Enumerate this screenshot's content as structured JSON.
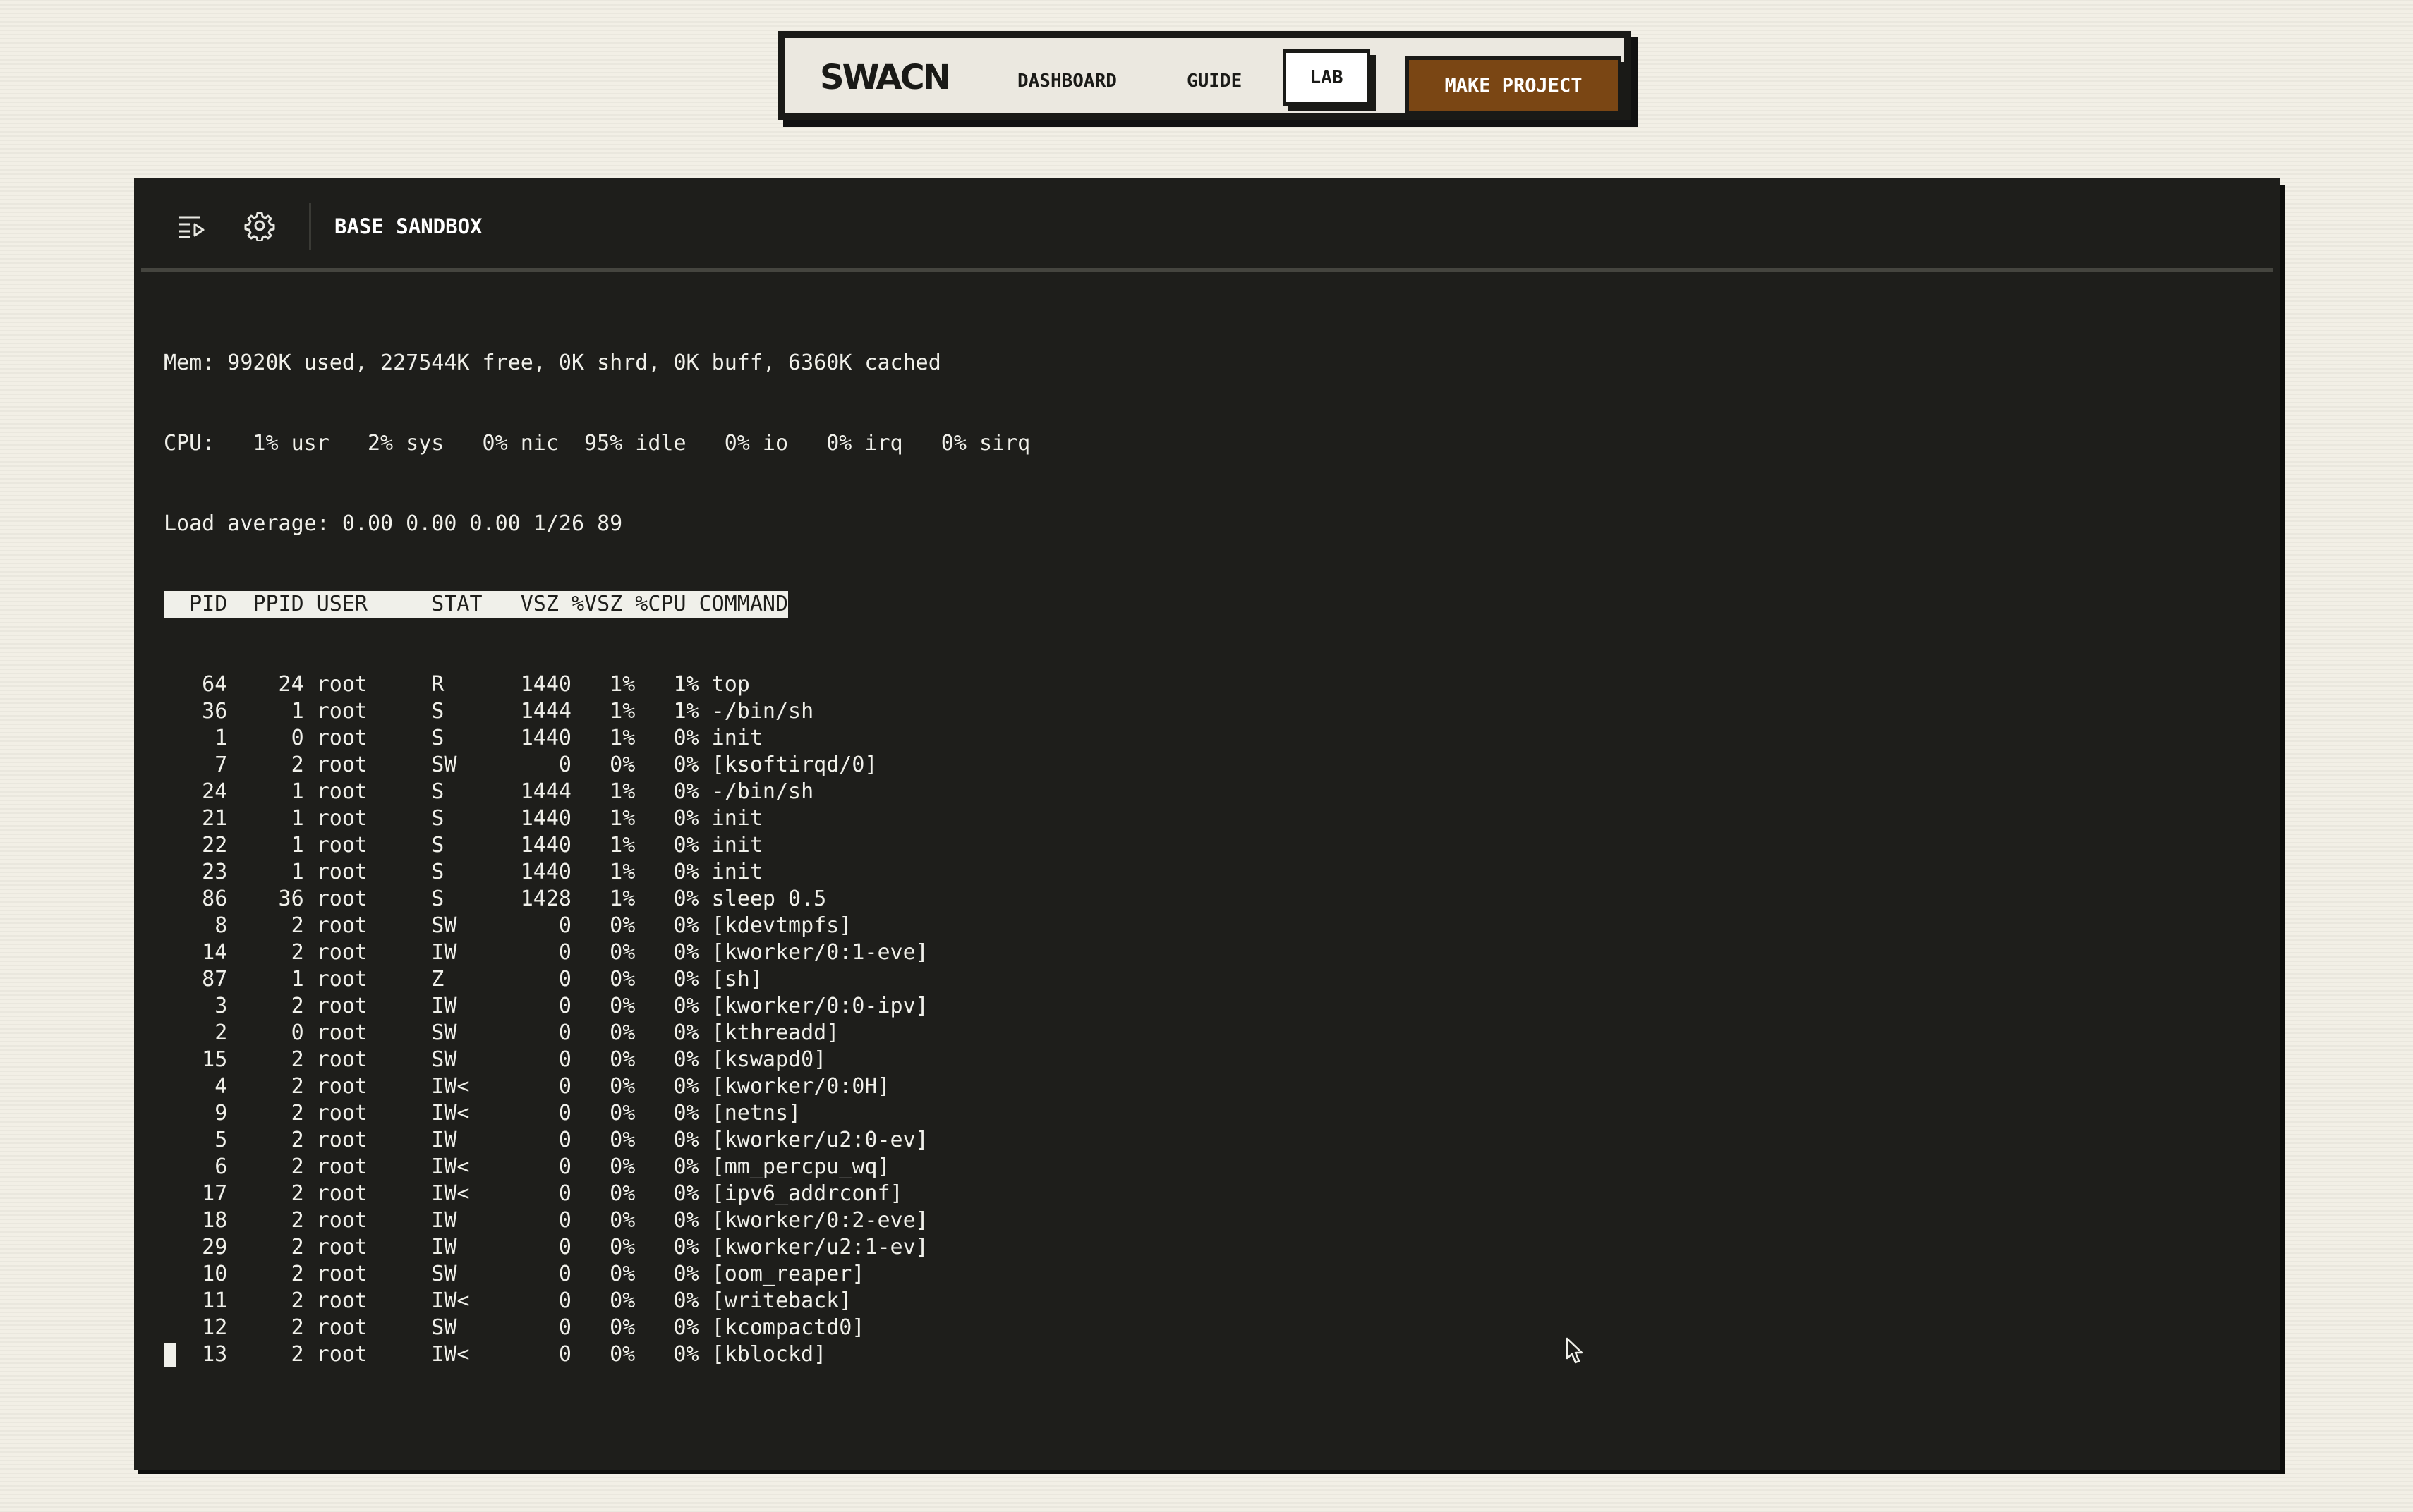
{
  "nav": {
    "logo": "SWACN",
    "links": [
      "DASHBOARD",
      "GUIDE",
      "LAB"
    ],
    "active_link": "LAB",
    "cta": "MAKE PROJECT",
    "cta_color": "#7a4614"
  },
  "terminal": {
    "title": "BASE SANDBOX",
    "icons": [
      "playlist-menu-icon",
      "gear-icon"
    ],
    "top_output": {
      "mem": "Mem: 9920K used, 227544K free, 0K shrd, 0K buff, 6360K cached",
      "cpu": "CPU:   1% usr   2% sys   0% nic  95% idle   0% io   0% irq   0% sirq",
      "load": "Load average: 0.00 0.00 0.00 1/26 89",
      "header": "  PID  PPID USER     STAT   VSZ %VSZ %CPU COMMAND",
      "processes": [
        [
          "64",
          "24",
          "root",
          "R",
          "1440",
          "1%",
          "1%",
          "top"
        ],
        [
          "36",
          "1",
          "root",
          "S",
          "1444",
          "1%",
          "1%",
          "-/bin/sh"
        ],
        [
          "1",
          "0",
          "root",
          "S",
          "1440",
          "1%",
          "0%",
          "init"
        ],
        [
          "7",
          "2",
          "root",
          "SW",
          "0",
          "0%",
          "0%",
          "[ksoftirqd/0]"
        ],
        [
          "24",
          "1",
          "root",
          "S",
          "1444",
          "1%",
          "0%",
          "-/bin/sh"
        ],
        [
          "21",
          "1",
          "root",
          "S",
          "1440",
          "1%",
          "0%",
          "init"
        ],
        [
          "22",
          "1",
          "root",
          "S",
          "1440",
          "1%",
          "0%",
          "init"
        ],
        [
          "23",
          "1",
          "root",
          "S",
          "1440",
          "1%",
          "0%",
          "init"
        ],
        [
          "86",
          "36",
          "root",
          "S",
          "1428",
          "1%",
          "0%",
          "sleep 0.5"
        ],
        [
          "8",
          "2",
          "root",
          "SW",
          "0",
          "0%",
          "0%",
          "[kdevtmpfs]"
        ],
        [
          "14",
          "2",
          "root",
          "IW",
          "0",
          "0%",
          "0%",
          "[kworker/0:1-eve]"
        ],
        [
          "87",
          "1",
          "root",
          "Z",
          "0",
          "0%",
          "0%",
          "[sh]"
        ],
        [
          "3",
          "2",
          "root",
          "IW",
          "0",
          "0%",
          "0%",
          "[kworker/0:0-ipv]"
        ],
        [
          "2",
          "0",
          "root",
          "SW",
          "0",
          "0%",
          "0%",
          "[kthreadd]"
        ],
        [
          "15",
          "2",
          "root",
          "SW",
          "0",
          "0%",
          "0%",
          "[kswapd0]"
        ],
        [
          "4",
          "2",
          "root",
          "IW<",
          "0",
          "0%",
          "0%",
          "[kworker/0:0H]"
        ],
        [
          "9",
          "2",
          "root",
          "IW<",
          "0",
          "0%",
          "0%",
          "[netns]"
        ],
        [
          "5",
          "2",
          "root",
          "IW",
          "0",
          "0%",
          "0%",
          "[kworker/u2:0-ev]"
        ],
        [
          "6",
          "2",
          "root",
          "IW<",
          "0",
          "0%",
          "0%",
          "[mm_percpu_wq]"
        ],
        [
          "17",
          "2",
          "root",
          "IW<",
          "0",
          "0%",
          "0%",
          "[ipv6_addrconf]"
        ],
        [
          "18",
          "2",
          "root",
          "IW",
          "0",
          "0%",
          "0%",
          "[kworker/0:2-eve]"
        ],
        [
          "29",
          "2",
          "root",
          "IW",
          "0",
          "0%",
          "0%",
          "[kworker/u2:1-ev]"
        ],
        [
          "10",
          "2",
          "root",
          "SW",
          "0",
          "0%",
          "0%",
          "[oom_reaper]"
        ],
        [
          "11",
          "2",
          "root",
          "IW<",
          "0",
          "0%",
          "0%",
          "[writeback]"
        ],
        [
          "12",
          "2",
          "root",
          "SW",
          "0",
          "0%",
          "0%",
          "[kcompactd0]"
        ],
        [
          "13",
          "2",
          "root",
          "IW<",
          "0",
          "0%",
          "0%",
          "[kblockd]"
        ]
      ]
    },
    "colors": {
      "background": "#1e1e1b",
      "text": "#f0f0ea"
    }
  }
}
